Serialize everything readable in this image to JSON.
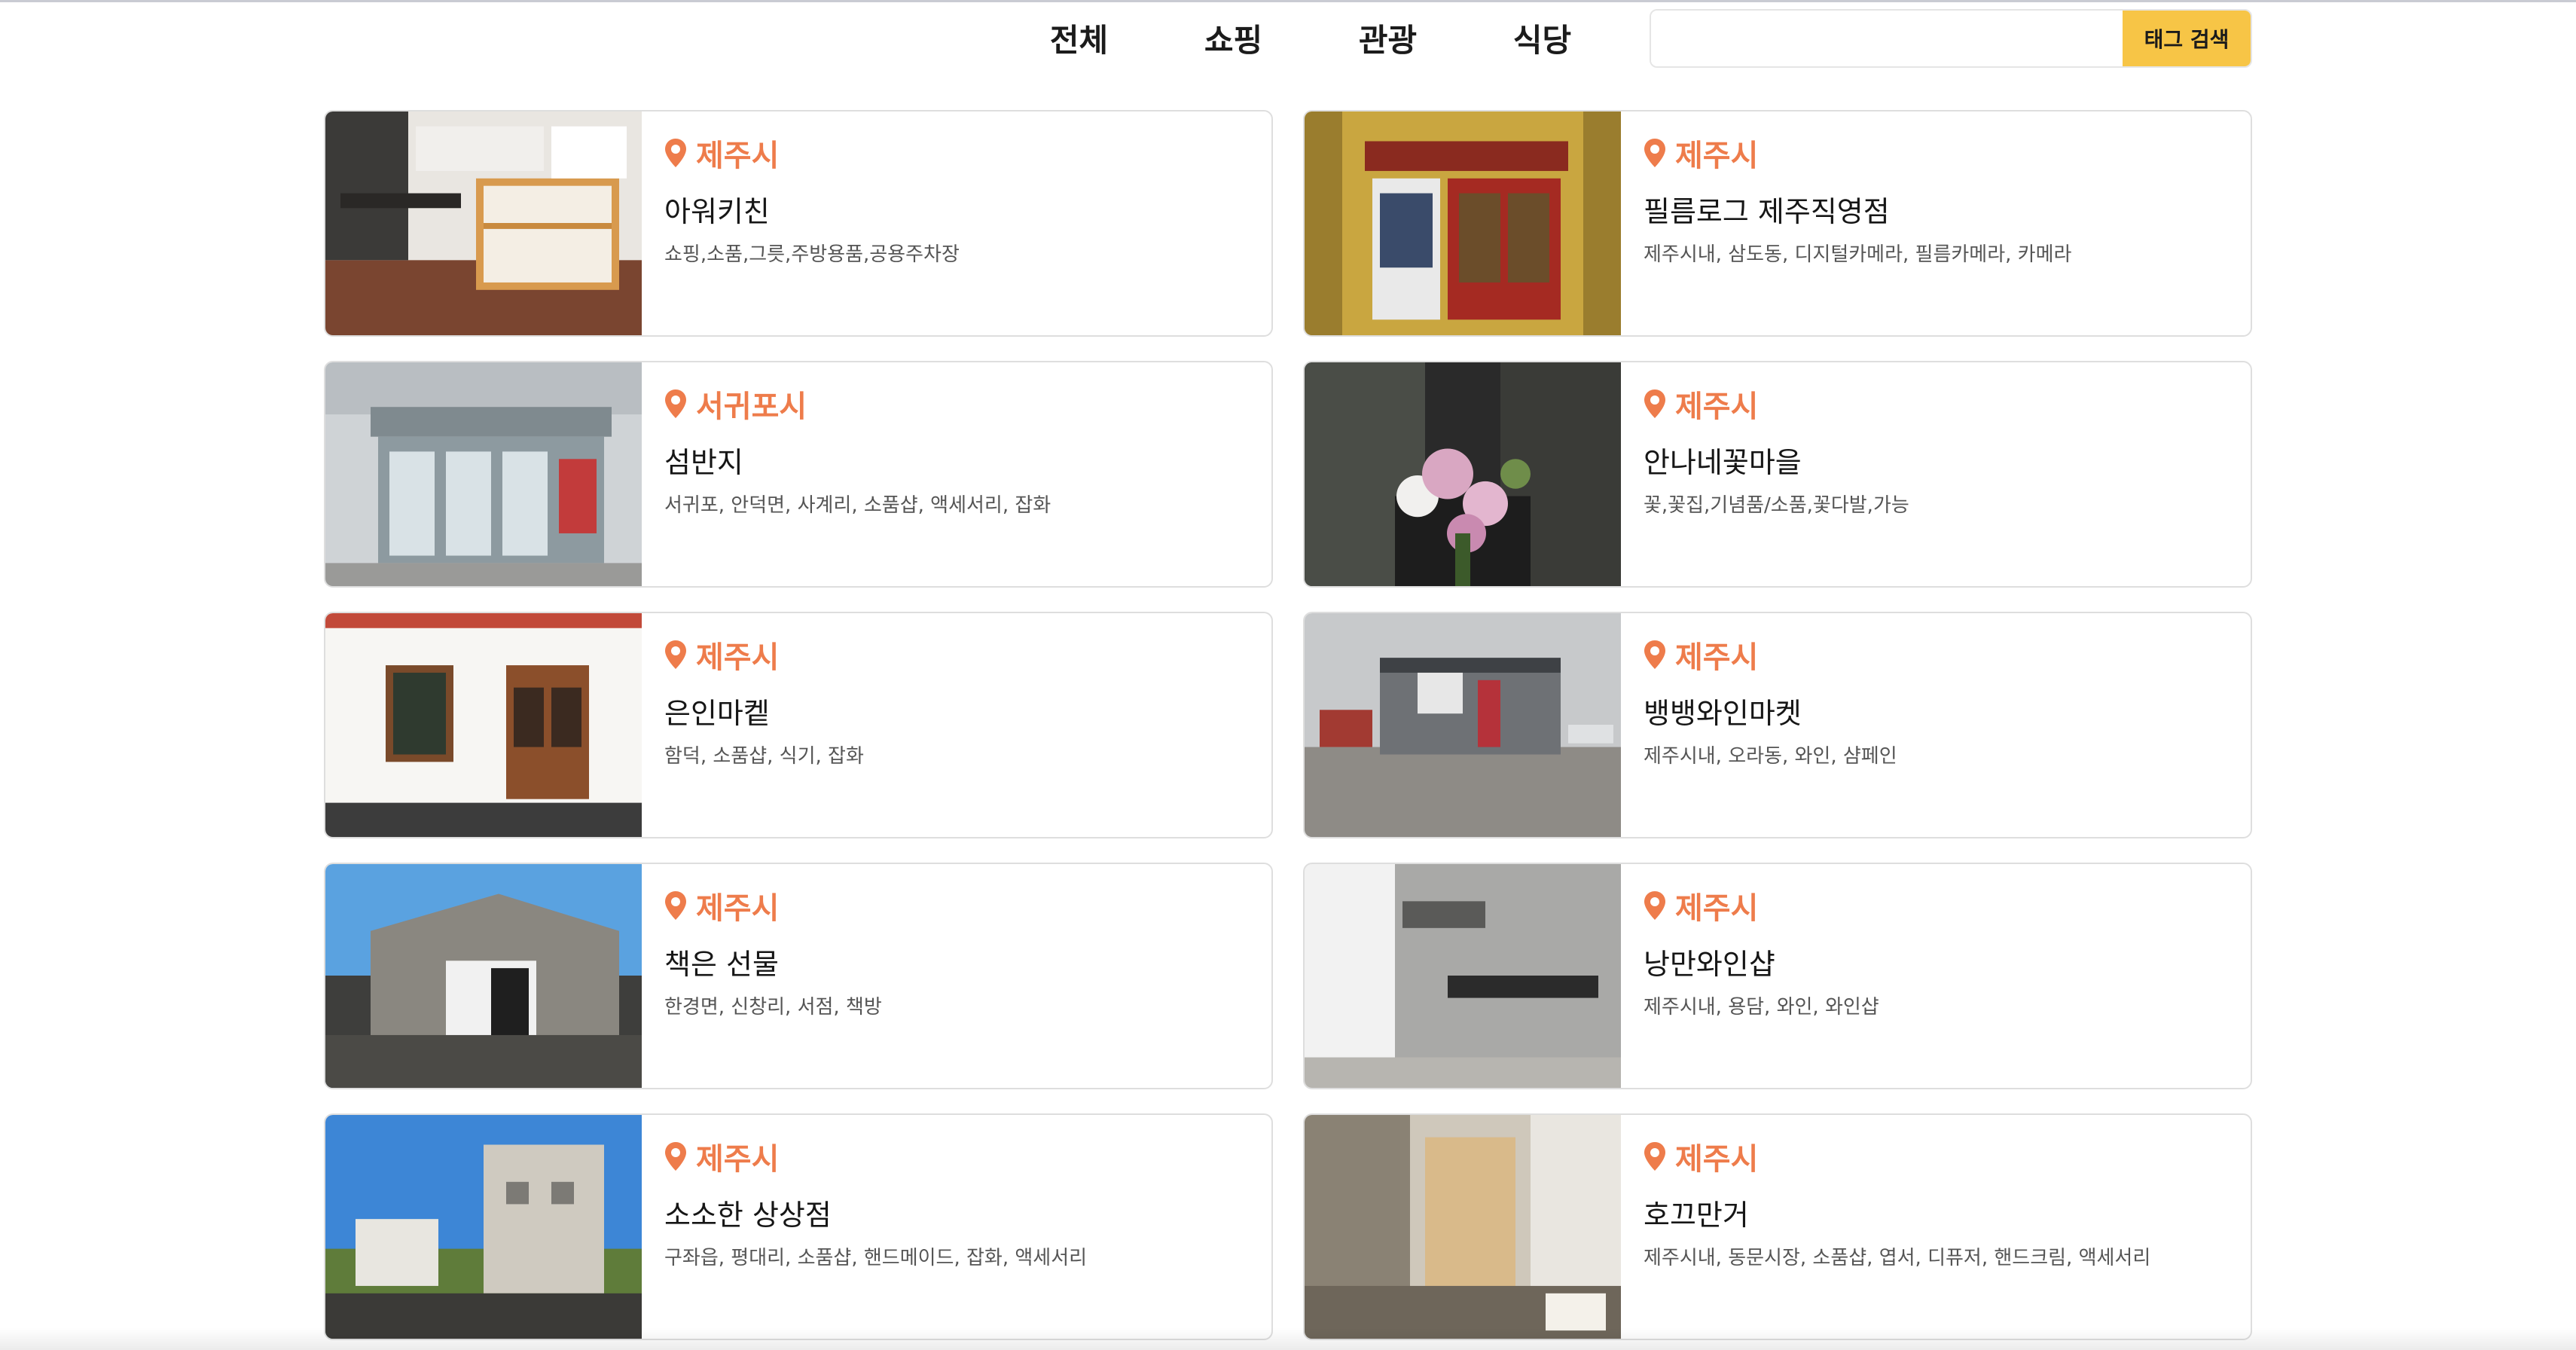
{
  "nav": {
    "tabs": [
      {
        "label": "전체"
      },
      {
        "label": "쇼핑"
      },
      {
        "label": "관광"
      },
      {
        "label": "식당"
      }
    ]
  },
  "search": {
    "value": "",
    "button_label": "태그 검색"
  },
  "colors": {
    "accent_region": "#ee7c4b",
    "search_button": "#f7c546"
  },
  "places": [
    {
      "region": "제주시",
      "name": "아워키친",
      "tags": "쇼핑,소품,그릇,주방용품,공용주차장"
    },
    {
      "region": "제주시",
      "name": "필름로그 제주직영점",
      "tags": "제주시내, 삼도동, 디지털카메라, 필름카메라, 카메라"
    },
    {
      "region": "서귀포시",
      "name": "섬반지",
      "tags": "서귀포, 안덕면, 사계리, 소품샵, 액세서리, 잡화"
    },
    {
      "region": "제주시",
      "name": "안나네꽃마을",
      "tags": "꽃,꽃집,기념품/소품,꽃다발,가능"
    },
    {
      "region": "제주시",
      "name": "은인마켙",
      "tags": "함덕, 소품샵, 식기, 잡화"
    },
    {
      "region": "제주시",
      "name": "뱅뱅와인마켓",
      "tags": "제주시내, 오라동, 와인, 샴페인"
    },
    {
      "region": "제주시",
      "name": "책은 선물",
      "tags": "한경면, 신창리, 서점, 책방"
    },
    {
      "region": "제주시",
      "name": "낭만와인샵",
      "tags": "제주시내, 용담, 와인, 와인샵"
    },
    {
      "region": "제주시",
      "name": "소소한 상상점",
      "tags": "구좌읍, 평대리, 소품샵, 핸드메이드, 잡화, 액세서리"
    },
    {
      "region": "제주시",
      "name": "호끄만거",
      "tags": "제주시내, 동문시장, 소품샵, 엽서, 디퓨저, 핸드크림, 액세서리"
    }
  ]
}
